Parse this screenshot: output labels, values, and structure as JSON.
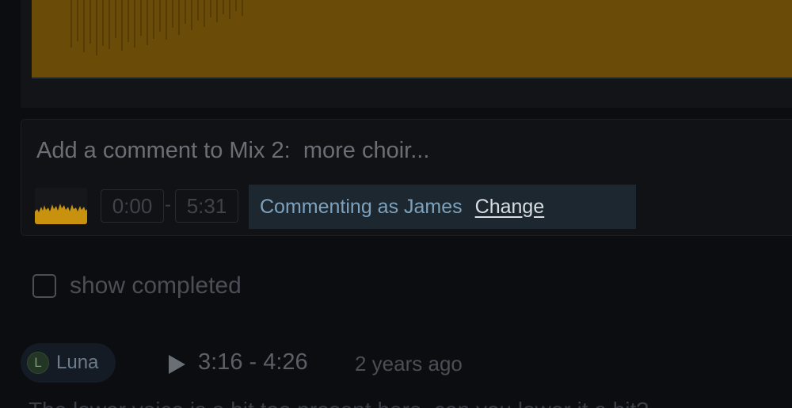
{
  "waveform": {
    "color": "#6a4c08",
    "icon": "waveform-graphic"
  },
  "comment_box": {
    "placeholder": "Add a comment to Mix 2:  more choir...",
    "time_start": "0:00",
    "time_separator": "-",
    "time_end": "5:31",
    "commenting_as": "Commenting as James",
    "change_label": "Change"
  },
  "filters": {
    "show_completed_label": "show completed",
    "show_completed_checked": false
  },
  "comments": [
    {
      "author_initial": "L",
      "author": "Luna",
      "range": "3:16 - 4:26",
      "age": "2 years ago",
      "text": "The lower voice is a bit too present here, can you lower it a bit?"
    }
  ],
  "colors": {
    "background": "#0c0d10",
    "accent_link": "#7fa2bc",
    "commenting_bar": "#1c2730"
  }
}
